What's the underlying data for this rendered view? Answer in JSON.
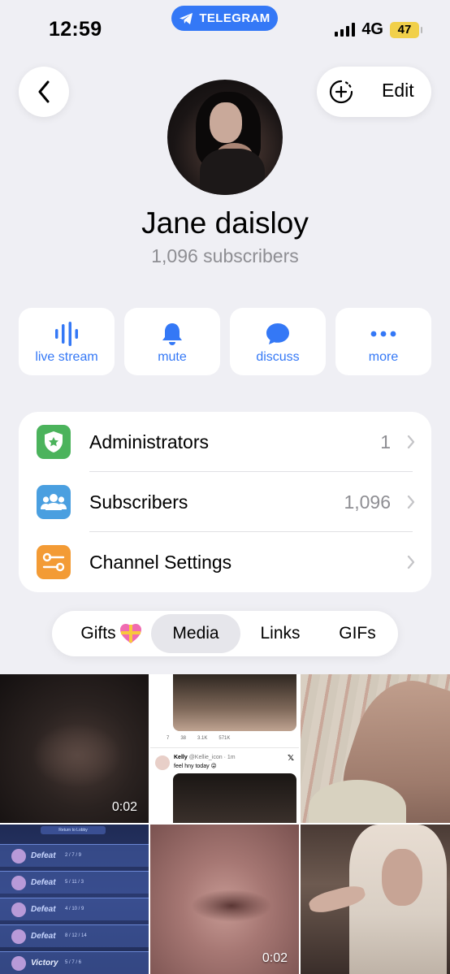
{
  "status_bar": {
    "time": "12:59",
    "pill_label": "TELEGRAM",
    "network": "4G",
    "battery": "47"
  },
  "header": {
    "edit_label": "Edit"
  },
  "profile": {
    "name": "Jane daisloy",
    "subscribers": "1,096 subscribers"
  },
  "actions": [
    {
      "label": "live stream",
      "icon": "live-stream-icon"
    },
    {
      "label": "mute",
      "icon": "bell-icon"
    },
    {
      "label": "discuss",
      "icon": "chat-bubble-icon"
    },
    {
      "label": "more",
      "icon": "more-dots-icon"
    }
  ],
  "info": [
    {
      "label": "Administrators",
      "value": "1",
      "icon": "admin-badge-icon",
      "color": "#4bb35c"
    },
    {
      "label": "Subscribers",
      "value": "1,096",
      "icon": "people-icon",
      "color": "#4a9fe0"
    },
    {
      "label": "Channel Settings",
      "value": "",
      "icon": "settings-toggle-icon",
      "color": "#f39b35"
    }
  ],
  "tabs": [
    {
      "label": "Gifts",
      "active": false
    },
    {
      "label": "Media",
      "active": true
    },
    {
      "label": "Links",
      "active": false
    },
    {
      "label": "GIFs",
      "active": false
    }
  ],
  "media": {
    "tile1_duration": "0:02",
    "tile5_duration": "0:02",
    "tweet_author": "Kelly",
    "tweet_handle": "@Kellie_icon · 1m",
    "tweet_text": "feel hny today 😜",
    "tweet_stats": [
      "7",
      "38",
      "3.1K",
      "571K"
    ],
    "game_header": "Return to Lobby",
    "game_results": [
      {
        "result": "Defeat",
        "score": "2 / 7 / 9"
      },
      {
        "result": "Defeat",
        "score": "5 / 11 / 3"
      },
      {
        "result": "Defeat",
        "score": "4 / 10 / 9"
      },
      {
        "result": "Defeat",
        "score": "8 / 12 / 14"
      },
      {
        "result": "Victory",
        "score": "5 / 7 / 6"
      }
    ]
  },
  "colors": {
    "accent": "#3478f6",
    "background": "#efeff4"
  }
}
